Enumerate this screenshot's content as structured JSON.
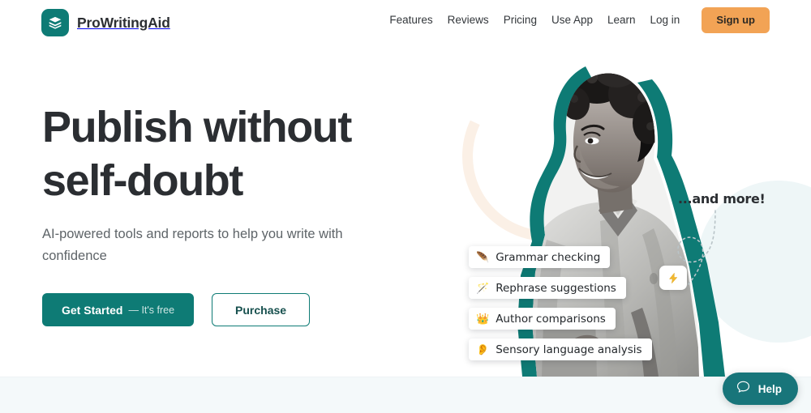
{
  "header": {
    "brand_name": "ProWritingAid",
    "logo_icon": "book-logo-icon",
    "nav_links": [
      {
        "label": "Features"
      },
      {
        "label": "Reviews"
      },
      {
        "label": "Pricing"
      },
      {
        "label": "Use App"
      },
      {
        "label": "Learn"
      },
      {
        "label": "Log in"
      }
    ],
    "signup_label": "Sign up",
    "signup_color": "#f2a355"
  },
  "hero": {
    "headline": "Publish without\nself-doubt",
    "subhead": "AI-powered tools and reports to help you write with confidence",
    "primary_cta": {
      "main": "Get Started",
      "sub": "— It's free",
      "color": "#0e7b75"
    },
    "secondary_cta": {
      "label": "Purchase",
      "border_color": "#0e7b75"
    },
    "art": {
      "and_more_label": "...and more!",
      "bolt_icon": "lightning-bolt-icon",
      "photo_alt": "smiling-woman-photo"
    },
    "chips": [
      {
        "icon": "feather-icon",
        "glyph": "🪶",
        "label": "Grammar checking"
      },
      {
        "icon": "magic-wand-icon",
        "glyph": "🪄",
        "label": "Rephrase suggestions"
      },
      {
        "icon": "crown-icon",
        "glyph": "👑",
        "label": "Author comparisons"
      },
      {
        "icon": "ear-icon",
        "glyph": "👂",
        "label": "Sensory language analysis"
      }
    ]
  },
  "help_widget": {
    "label": "Help",
    "icon": "chat-bubble-icon",
    "color": "#18757a"
  }
}
